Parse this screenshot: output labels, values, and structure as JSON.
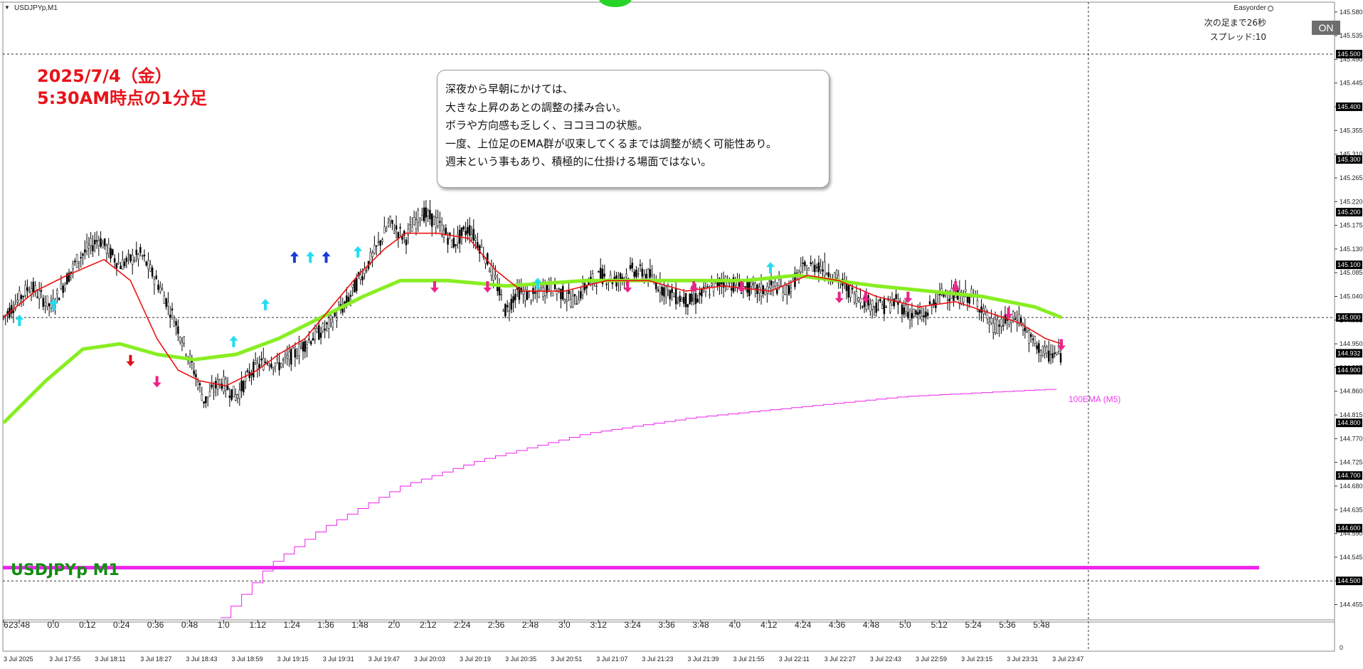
{
  "window": {
    "symbol_timeframe": "USDJPYp,M1",
    "menu_arrow": "▼"
  },
  "ea_panel": {
    "name": "Easyorder",
    "next_bar_text": "次の足まで26秒",
    "spread_text": "スプレッド:10",
    "on_label": "ON"
  },
  "annotation": {
    "date_line1": "2025/7/4（金）",
    "date_line2": "5:30AM時点の1分足",
    "comment_lines": [
      "深夜から早朝にかけては、",
      "大きな上昇のあとの調整の揉み合い。",
      "ボラや方向感も乏しく、ヨコヨコの状態。",
      "一度、上位足のEMA群が収束してくるまでは調整が続く可能性あり。",
      "週末という事もあり、積極的に仕掛ける場面ではない。"
    ],
    "symbol_title": "USDJPYp M1",
    "ema_label": "100EMA (M5)"
  },
  "colors": {
    "ema_fast": "#ee1111",
    "ema_slow": "#88ee22",
    "ema_m5": "#ee22ee",
    "band_line": "#ee22ee",
    "arrow_up": "#22ddee",
    "arrow_up_dark": "#1a3bd6",
    "arrow_down": "#ee2288",
    "arrow_down_red": "#dd1111",
    "candle": "#000000"
  },
  "chart_data": {
    "type": "line",
    "y_range": [
      144.43,
      145.6
    ],
    "y_ticks": [
      "145.580",
      "145.535",
      "145.490",
      "145.445",
      "145.400",
      "145.355",
      "145.310",
      "145.265",
      "145.220",
      "145.175",
      "145.130",
      "145.085",
      "145.040",
      "144.995",
      "144.950",
      "144.905",
      "144.860",
      "144.815",
      "144.770",
      "144.725",
      "144.680",
      "144.635",
      "144.590",
      "144.545",
      "144.500",
      "144.455"
    ],
    "y_ticks_bold": [
      "145.500",
      "145.400",
      "145.300",
      "145.200",
      "145.100",
      "145.000",
      "144.932",
      "144.900",
      "144.800",
      "144.700",
      "144.600",
      "144.500"
    ],
    "current_price": "144.932",
    "dotted_levels": [
      145.5,
      145.0,
      144.5
    ],
    "solid_level": 144.525,
    "time_labels_top": [
      "6",
      "23:48",
      "0:0",
      "0:12",
      "0:24",
      "0:36",
      "0:48",
      "1:0",
      "1:12",
      "1:24",
      "1:36",
      "1:48",
      "2:0",
      "2:12",
      "2:24",
      "2:36",
      "2:48",
      "3:0",
      "3:12",
      "3:24",
      "3:36",
      "3:48",
      "4:0",
      "4:12",
      "4:24",
      "4:36",
      "4:48",
      "5:0",
      "5:12",
      "5:24",
      "5:36",
      "5:48"
    ],
    "time_labels_bottom": [
      "3 Jul 2025",
      "3 Jul 17:55",
      "3 Jul 18:11",
      "3 Jul 18:27",
      "3 Jul 18:43",
      "3 Jul 18:59",
      "3 Jul 19:15",
      "3 Jul 19:31",
      "3 Jul 19:47",
      "3 Jul 20:03",
      "3 Jul 20:19",
      "3 Jul 20:35",
      "3 Jul 20:51",
      "3 Jul 21:07",
      "3 Jul 21:23",
      "3 Jul 21:39",
      "3 Jul 21:55",
      "3 Jul 22:11",
      "3 Jul 22:27",
      "3 Jul 22:43",
      "3 Jul 22:59",
      "3 Jul 23:15",
      "3 Jul 23:31",
      "3 Jul 23:47"
    ],
    "indicator_axis_label": "0",
    "price_path": [
      [
        0,
        145.0
      ],
      [
        10,
        145.06
      ],
      [
        18,
        145.02
      ],
      [
        28,
        145.11
      ],
      [
        36,
        145.15
      ],
      [
        44,
        145.1
      ],
      [
        52,
        145.12
      ],
      [
        60,
        145.05
      ],
      [
        66,
        144.98
      ],
      [
        72,
        144.9
      ],
      [
        76,
        144.84
      ],
      [
        82,
        144.88
      ],
      [
        88,
        144.85
      ],
      [
        94,
        144.9
      ],
      [
        100,
        144.92
      ],
      [
        104,
        144.91
      ],
      [
        110,
        144.93
      ],
      [
        116,
        144.96
      ],
      [
        122,
        144.98
      ],
      [
        130,
        145.03
      ],
      [
        134,
        145.07
      ],
      [
        140,
        145.12
      ],
      [
        146,
        145.18
      ],
      [
        152,
        145.15
      ],
      [
        158,
        145.2
      ],
      [
        164,
        145.18
      ],
      [
        170,
        145.14
      ],
      [
        176,
        145.17
      ],
      [
        182,
        145.12
      ],
      [
        186,
        145.07
      ],
      [
        190,
        145.01
      ],
      [
        194,
        145.05
      ],
      [
        200,
        145.04
      ],
      [
        206,
        145.06
      ],
      [
        210,
        145.05
      ],
      [
        216,
        145.03
      ],
      [
        220,
        145.06
      ],
      [
        226,
        145.08
      ],
      [
        232,
        145.07
      ],
      [
        238,
        145.09
      ],
      [
        244,
        145.08
      ],
      [
        248,
        145.06
      ],
      [
        254,
        145.04
      ],
      [
        260,
        145.03
      ],
      [
        266,
        145.05
      ],
      [
        272,
        145.07
      ],
      [
        278,
        145.06
      ],
      [
        286,
        145.05
      ],
      [
        292,
        145.06
      ],
      [
        296,
        145.05
      ],
      [
        302,
        145.09
      ],
      [
        308,
        145.1
      ],
      [
        314,
        145.08
      ],
      [
        320,
        145.05
      ],
      [
        326,
        145.03
      ],
      [
        332,
        145.02
      ],
      [
        338,
        145.03
      ],
      [
        342,
        145.01
      ],
      [
        348,
        145.0
      ],
      [
        352,
        145.03
      ],
      [
        356,
        145.05
      ],
      [
        360,
        145.04
      ],
      [
        366,
        145.04
      ],
      [
        370,
        145.02
      ],
      [
        374,
        144.98
      ],
      [
        378,
        144.99
      ],
      [
        384,
        145.0
      ],
      [
        388,
        144.96
      ],
      [
        394,
        144.93
      ],
      [
        400,
        144.93
      ]
    ],
    "ema_fast_path": [
      [
        0,
        145.0
      ],
      [
        12,
        145.05
      ],
      [
        24,
        145.08
      ],
      [
        38,
        145.11
      ],
      [
        48,
        145.07
      ],
      [
        58,
        144.96
      ],
      [
        66,
        144.9
      ],
      [
        74,
        144.88
      ],
      [
        84,
        144.87
      ],
      [
        96,
        144.9
      ],
      [
        104,
        144.93
      ],
      [
        114,
        144.96
      ],
      [
        124,
        145.02
      ],
      [
        134,
        145.08
      ],
      [
        144,
        145.13
      ],
      [
        152,
        145.16
      ],
      [
        164,
        145.16
      ],
      [
        176,
        145.15
      ],
      [
        186,
        145.09
      ],
      [
        196,
        145.05
      ],
      [
        212,
        145.05
      ],
      [
        228,
        145.07
      ],
      [
        244,
        145.07
      ],
      [
        258,
        145.05
      ],
      [
        272,
        145.06
      ],
      [
        290,
        145.05
      ],
      [
        304,
        145.08
      ],
      [
        316,
        145.07
      ],
      [
        330,
        145.04
      ],
      [
        346,
        145.02
      ],
      [
        360,
        145.03
      ],
      [
        372,
        145.01
      ],
      [
        384,
        144.99
      ],
      [
        394,
        144.96
      ],
      [
        400,
        144.95
      ]
    ],
    "ema_slow_path": [
      [
        0,
        144.8
      ],
      [
        16,
        144.88
      ],
      [
        30,
        144.94
      ],
      [
        44,
        144.95
      ],
      [
        58,
        144.93
      ],
      [
        72,
        144.92
      ],
      [
        88,
        144.93
      ],
      [
        104,
        144.96
      ],
      [
        120,
        145.0
      ],
      [
        136,
        145.04
      ],
      [
        150,
        145.07
      ],
      [
        168,
        145.07
      ],
      [
        190,
        145.06
      ],
      [
        220,
        145.07
      ],
      [
        250,
        145.07
      ],
      [
        280,
        145.07
      ],
      [
        300,
        145.08
      ],
      [
        330,
        145.06
      ],
      [
        350,
        145.05
      ],
      [
        370,
        145.04
      ],
      [
        390,
        145.02
      ],
      [
        400,
        145.0
      ]
    ],
    "ema_m5_path": [
      [
        82,
        144.43
      ],
      [
        100,
        144.53
      ],
      [
        120,
        144.6
      ],
      [
        150,
        144.68
      ],
      [
        180,
        144.73
      ],
      [
        220,
        144.78
      ],
      [
        260,
        144.81
      ],
      [
        300,
        144.83
      ],
      [
        340,
        144.85
      ],
      [
        380,
        144.86
      ],
      [
        400,
        144.865
      ]
    ],
    "arrows_up": [
      [
        6,
        145.0
      ],
      [
        19,
        145.03
      ],
      [
        87,
        144.96
      ],
      [
        99,
        145.03
      ],
      [
        116,
        145.12
      ],
      [
        134,
        145.13
      ],
      [
        202,
        145.07
      ],
      [
        290,
        145.1
      ]
    ],
    "arrows_up_dark": [
      [
        110,
        145.12
      ],
      [
        122,
        145.12
      ]
    ],
    "arrows_down": [
      [
        58,
        144.87
      ],
      [
        163,
        145.05
      ],
      [
        183,
        145.05
      ],
      [
        236,
        145.05
      ],
      [
        261,
        145.05
      ],
      [
        279,
        145.05
      ],
      [
        316,
        145.03
      ],
      [
        326,
        145.03
      ],
      [
        342,
        145.03
      ],
      [
        360,
        145.05
      ],
      [
        380,
        145.0
      ],
      [
        400,
        144.94
      ]
    ],
    "arrows_down_red": [
      [
        48,
        144.91
      ]
    ]
  }
}
